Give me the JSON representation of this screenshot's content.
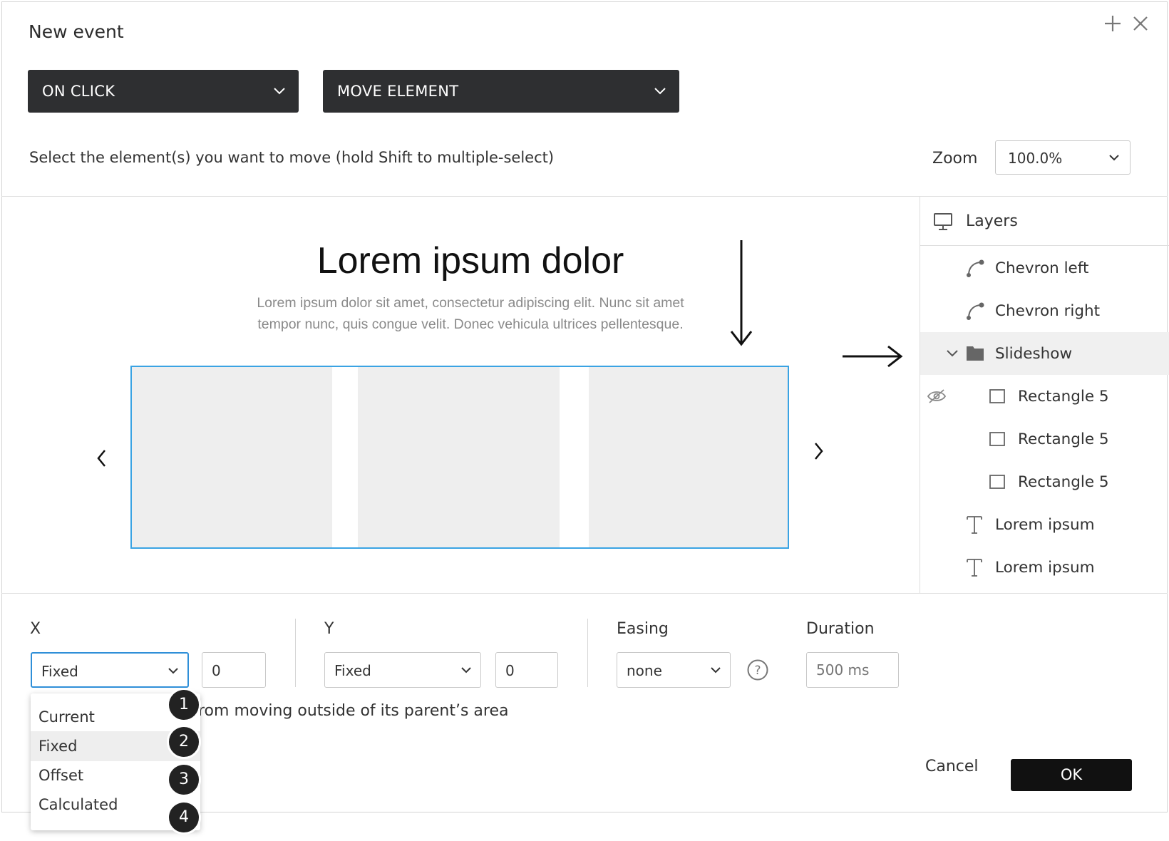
{
  "dialog": {
    "title": "New event",
    "add_icon": "plus-icon",
    "close_icon": "close-icon"
  },
  "trigger_select": {
    "value": "ON CLICK"
  },
  "action_select": {
    "value": "MOVE ELEMENT"
  },
  "instruction": "Select the element(s) you want to move (hold Shift to multiple-select)",
  "zoom": {
    "label": "Zoom",
    "value": "100.0%"
  },
  "canvas": {
    "heading": "Lorem ipsum dolor",
    "subtext_line1": "Lorem ipsum dolor sit amet, consectetur adipiscing elit. Nunc sit amet",
    "subtext_line2": "tempor nunc, quis congue velit. Donec vehicula ultrices pellentesque.",
    "slides_count": 3,
    "accent_color": "#3aa3e3"
  },
  "layers": {
    "title": "Layers",
    "items": [
      {
        "label": "Chevron left",
        "icon": "path-icon"
      },
      {
        "label": "Chevron right",
        "icon": "path-icon"
      },
      {
        "label": "Slideshow",
        "icon": "folder-icon",
        "expanded": true,
        "selected": true
      },
      {
        "label": "Rectangle 5",
        "icon": "rectangle-icon",
        "hidden": true
      },
      {
        "label": "Rectangle 5",
        "icon": "rectangle-icon"
      },
      {
        "label": "Rectangle 5",
        "icon": "rectangle-icon"
      },
      {
        "label": "Lorem ipsum",
        "icon": "text-icon"
      },
      {
        "label": "Lorem ipsum",
        "icon": "text-icon"
      }
    ]
  },
  "x": {
    "label": "X",
    "mode": "Fixed",
    "value": "0"
  },
  "y": {
    "label": "Y",
    "mode": "Fixed",
    "value": "0"
  },
  "easing": {
    "label": "Easing",
    "value": "none"
  },
  "duration": {
    "label": "Duration",
    "placeholder": "500 ms"
  },
  "x_dropdown": {
    "options": [
      "Current",
      "Fixed",
      "Offset",
      "Calculated"
    ],
    "highlighted": "Fixed",
    "badges": [
      "1",
      "2",
      "3",
      "4"
    ]
  },
  "constraint_text": "rom moving outside of its parent’s area",
  "buttons": {
    "cancel": "Cancel",
    "ok": "OK"
  }
}
